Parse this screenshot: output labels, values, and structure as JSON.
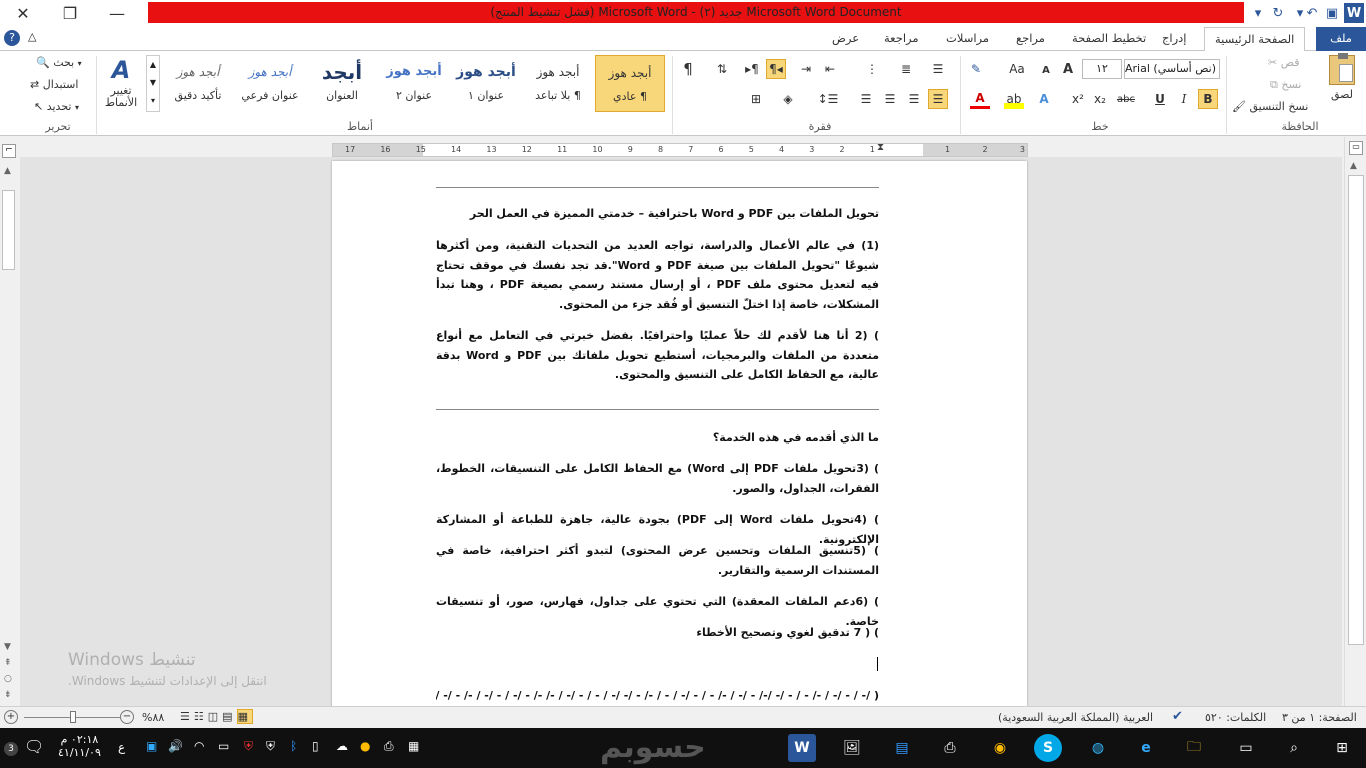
{
  "window": {
    "title": "Microsoft Word Document جديد (٢) - Microsoft Word (فشل تنشيط المنتج)"
  },
  "tabs": [
    {
      "label": "ملف"
    },
    {
      "label": "الصفحة الرئيسية"
    },
    {
      "label": "إدراج"
    },
    {
      "label": "تخطيط الصفحة"
    },
    {
      "label": "مراجع"
    },
    {
      "label": "مراسلات"
    },
    {
      "label": "مراجعة"
    },
    {
      "label": "عرض"
    }
  ],
  "ribbon": {
    "clipboard": {
      "label": "الحافظة",
      "paste": "لصق",
      "cut": "قص",
      "copy": "نسخ",
      "format_painter": "نسخ التنسيق"
    },
    "font": {
      "label": "خط",
      "font_name": "Arial (نص أساسي)",
      "font_size": "١٢",
      "grow_icon": "A",
      "shrink_icon": "A",
      "aa_icon": "Aa"
    },
    "paragraph": {
      "label": "فقرة"
    },
    "styles": {
      "label": "أنماط",
      "items": [
        {
          "preview": "أبجد هوز",
          "name": "¶ عادي"
        },
        {
          "preview": "أبجد هوز",
          "name": "¶ بلا تباعد"
        },
        {
          "preview": "أبجد هوز",
          "name": "عنوان ١"
        },
        {
          "preview": "أبجد هوز",
          "name": "عنوان ٢"
        },
        {
          "preview": "أبجد",
          "name": "العنوان"
        },
        {
          "preview": "أبجد هوز",
          "name": "عنوان فرعي"
        },
        {
          "preview": "أبجد هوز",
          "name": "تأكيد دقيق"
        }
      ],
      "change_styles": "تغيير الأنماط"
    },
    "editing": {
      "label": "تحرير",
      "find": "بحث",
      "replace": "استبدال",
      "select": "تحديد"
    }
  },
  "ruler": {
    "ticks_left": [
      "17",
      "16",
      "15",
      "14",
      "13",
      "12",
      "11",
      "10",
      "9",
      "8",
      "7",
      "6",
      "5",
      "4",
      "3",
      "2",
      "1"
    ],
    "ticks_right": [
      "1",
      "2",
      "3"
    ]
  },
  "document": {
    "heading": "تحويل الملفات بين PDF و Word باحترافية – خدمتي المميزة في العمل الحر",
    "p1": "(1) في عالم الأعمال والدراسة، تواجه العديد من التحديات التقنية، ومن أكثرها شيوعًا \"تحويل الملفات بين صيغة PDF و Word\".قد تجد نفسك في موقف تحتاج فيه لتعديل محتوى ملف PDF ، أو إرسال مستند رسمي بصيغة PDF ، وهنا تبدأ المشكلات، خاصة إذا اختلّ التنسيق أو فُقد جزء من المحتوى.",
    "p2": ") (2 أنا هنا لأقدم لك حلاً عمليًا واحترافيًا. بفضل خبرتي في التعامل مع أنواع متعددة من الملفات والبرمجيات، أستطيع تحويل ملفاتك بين PDF و Word بدقة عالية، مع الحفاظ الكامل على التنسيق والمحتوى.",
    "section": "ما الذي أقدمه في هذه الخدمة؟",
    "i3": ") (3تحويل ملفات PDF إلى Word) مع الحفاظ الكامل على التنسيقات، الخطوط، الفقرات، الجداول، والصور.",
    "i4": ") (4تحويل ملفات Word إلى PDF) بجودة عالية، جاهزة للطباعة أو المشاركة الإلكترونية.",
    "i5": ") (5تنسيق الملفات وتحسين عرض المحتوى) لتبدو أكثر احترافية، خاصة في المستندات الرسمية والتقارير.",
    "i6": ") (6دعم الملفات المعقدة) التي تحتوي على جداول، فهارس، صور، أو تنسيقات خاصة.",
    "i7": ") ( 7 تدقيق لغوي وتصحيح الأخطاء",
    "dashes": "( /- / - /- / -/ - / - /- /-/ - /- / -/ - / - /- / - / -/ - /- /- / - / - /- / -/ -/ - /- / - /- / -/ - /- / - )"
  },
  "watermark": {
    "line1": "تنشيط Windows",
    "line2": "انتقل إلى الإعدادات لتنشيط Windows."
  },
  "status": {
    "page": "الصفحة: ١ من ٣",
    "words": "الكلمات: ٥٢٠",
    "language": "العربية (المملكة العربية السعودية)",
    "zoom": "٨٨%"
  },
  "taskbar": {
    "time": "٠٢:١٨ م",
    "date": "٤١/١١/٠٩",
    "lang": "ع",
    "notification_count": "3",
    "brand": "حسوبم"
  }
}
